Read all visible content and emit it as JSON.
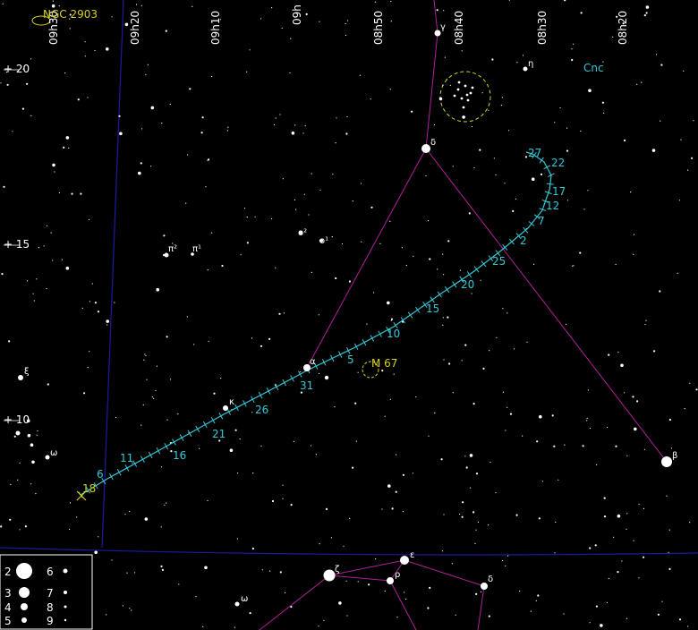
{
  "labels": {
    "ngc2903": "NGC 2903",
    "m67": "M 67",
    "cnc": "Cnc",
    "ra": [
      "09h30",
      "09h20",
      "09h10",
      "09h",
      "08h50",
      "08h40",
      "08h30",
      "08h20"
    ],
    "dec": [
      "+ 20",
      "+ 15",
      "+ 10"
    ],
    "stars": {
      "gamma": "γ",
      "eta": "η",
      "delta": "δ",
      "alpha": "α",
      "beta": "β",
      "kappa": "κ",
      "omicron2": "o²",
      "omicron1": "o¹",
      "pi2": "π²",
      "pi1": "π¹",
      "xi": "ξ",
      "omega": "ω",
      "zeta": "ζ",
      "epsilon": "ε",
      "rho": "ρ",
      "delta_hya": "δ",
      "omega_hya": "ω"
    }
  },
  "track": {
    "dates": [
      "18",
      "6",
      "11",
      "16",
      "21",
      "26",
      "31",
      "5",
      "10",
      "15",
      "20",
      "25",
      "2",
      "7",
      "12",
      "17",
      "22",
      "27"
    ]
  },
  "legend": {
    "magnitudes": [
      "2",
      "3",
      "4",
      "5",
      "6",
      "7",
      "8",
      "9"
    ]
  },
  "colors": {
    "background": "#000000",
    "grid": "#1a1aa0",
    "constellation": "#b0209a",
    "track": "#33c8d8",
    "deep_sky": "#d8d020",
    "star": "#ffffff"
  }
}
